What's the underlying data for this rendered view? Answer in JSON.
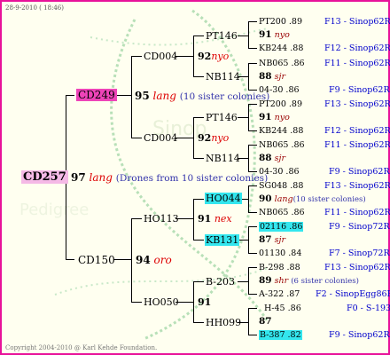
{
  "header": {
    "date": "28-9-2010 ( 18:46)"
  },
  "copyright": "Copyright 2004-2010 @ Karl Kehde Foundation.",
  "root": {
    "id": "CD257"
  },
  "level1": {
    "marker": "97",
    "race": "lang",
    "note": "(Drones from 10 sister colonies)",
    "sire": "CD249",
    "dam": "CD150"
  },
  "cd249": {
    "marker": "95",
    "race": "lang",
    "note": "(10 sister colonies)",
    "upper": "CD004",
    "lower": "CD004"
  },
  "cd150": {
    "marker": "94",
    "race": "oro",
    "upper": "HO113",
    "lower": "HO050"
  },
  "g3": {
    "pt146a": "PT146",
    "m92a": "92",
    "r92a": "nyo",
    "nb114a": "NB114",
    "pt146b": "PT146",
    "m92b": "92",
    "r92b": "nyo",
    "nb114b": "NB114",
    "ho044": "HO044",
    "m91a": "91",
    "r91a": "nex",
    "kb131": "KB131",
    "b203": "B-203",
    "m91b": "91",
    "hh099": "HH099"
  },
  "rows": [
    {
      "code": "PT200",
      "year": ".89",
      "loc": "F13 - Sinop62R"
    },
    {
      "code": "91",
      "race": "nyo"
    },
    {
      "code": "KB244",
      "year": ".88",
      "loc": "F12 - Sinop62R"
    },
    {
      "code": "NB065",
      "year": ".86",
      "loc": "F11 - Sinop62R"
    },
    {
      "code": "88",
      "race": "sjr"
    },
    {
      "code": "04-30",
      "year": ".86",
      "loc": "F9 - Sinop62R"
    },
    {
      "code": "PT200",
      "year": ".89",
      "loc": "F13 - Sinop62R"
    },
    {
      "code": "91",
      "race": "nyo"
    },
    {
      "code": "KB244",
      "year": ".88",
      "loc": "F12 - Sinop62R"
    },
    {
      "code": "NB065",
      "year": ".86",
      "loc": "F11 - Sinop62R"
    },
    {
      "code": "88",
      "race": "sjr"
    },
    {
      "code": "04-30",
      "year": ".86",
      "loc": "F9 - Sinop62R"
    },
    {
      "code": "SG048",
      "year": ".88",
      "loc": "F13 - Sinop62R"
    },
    {
      "code": "90",
      "race": "lang",
      "note": "(10 sister colonies)"
    },
    {
      "code": "NB065",
      "year": ".86",
      "loc": "F11 - Sinop62R"
    },
    {
      "code": "02116",
      "year": ".86",
      "loc": "F9 - Sinop72R"
    },
    {
      "code": "87",
      "race": "sjr"
    },
    {
      "code": "01130",
      "year": ".84",
      "loc": "F7 - Sinop72R"
    },
    {
      "code": "B-298",
      "year": ".88",
      "loc": "F13 - Sinop62R"
    },
    {
      "code": "89",
      "race": "shr",
      "note": "(6 sister colonies)"
    },
    {
      "code": "A-322",
      "year": ".87",
      "loc": "F2 - SinopEgg86R"
    },
    {
      "code": "H-45",
      "year": ".86",
      "loc": "F0 - S-193"
    },
    {
      "code": "87"
    },
    {
      "code": "B-387",
      "year": ".82",
      "loc": "F9 - Sinop62R"
    }
  ]
}
